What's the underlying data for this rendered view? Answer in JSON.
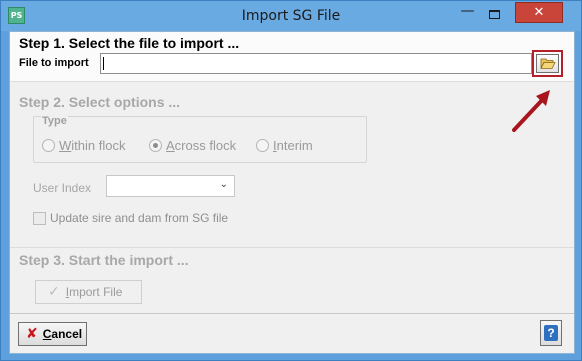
{
  "window": {
    "title": "Import SG File",
    "app_icon_text": "PS",
    "minimize_symbol": "—",
    "close_symbol": "✕"
  },
  "step1": {
    "title": "Step 1. Select the file to import ...",
    "file_label": "File to import",
    "file_value": "",
    "browse_icon": "folder-open-icon"
  },
  "step2": {
    "title": "Step 2. Select options ...",
    "type_group": {
      "legend": "Type",
      "options": [
        {
          "accel": "W",
          "rest": "ithin flock",
          "selected": false
        },
        {
          "accel": "A",
          "rest": "cross flock",
          "selected": true
        },
        {
          "accel": "I",
          "rest": "nterim",
          "selected": false
        }
      ]
    },
    "user_index_label": "User Index",
    "user_index_value": "",
    "update_checkbox_label": "Update sire and dam from SG file",
    "update_checked": false
  },
  "step3": {
    "title": "Step 3. Start the import ...",
    "import_button": {
      "accel": "I",
      "rest": "mport File"
    }
  },
  "footer": {
    "cancel_button": {
      "accel": "C",
      "rest": "ancel"
    },
    "help_symbol": "?"
  },
  "colors": {
    "title_bar": "#6aaae2",
    "close_button": "#c9453a",
    "highlight_border": "#b3202a",
    "disabled_text": "#a8a8a8"
  }
}
